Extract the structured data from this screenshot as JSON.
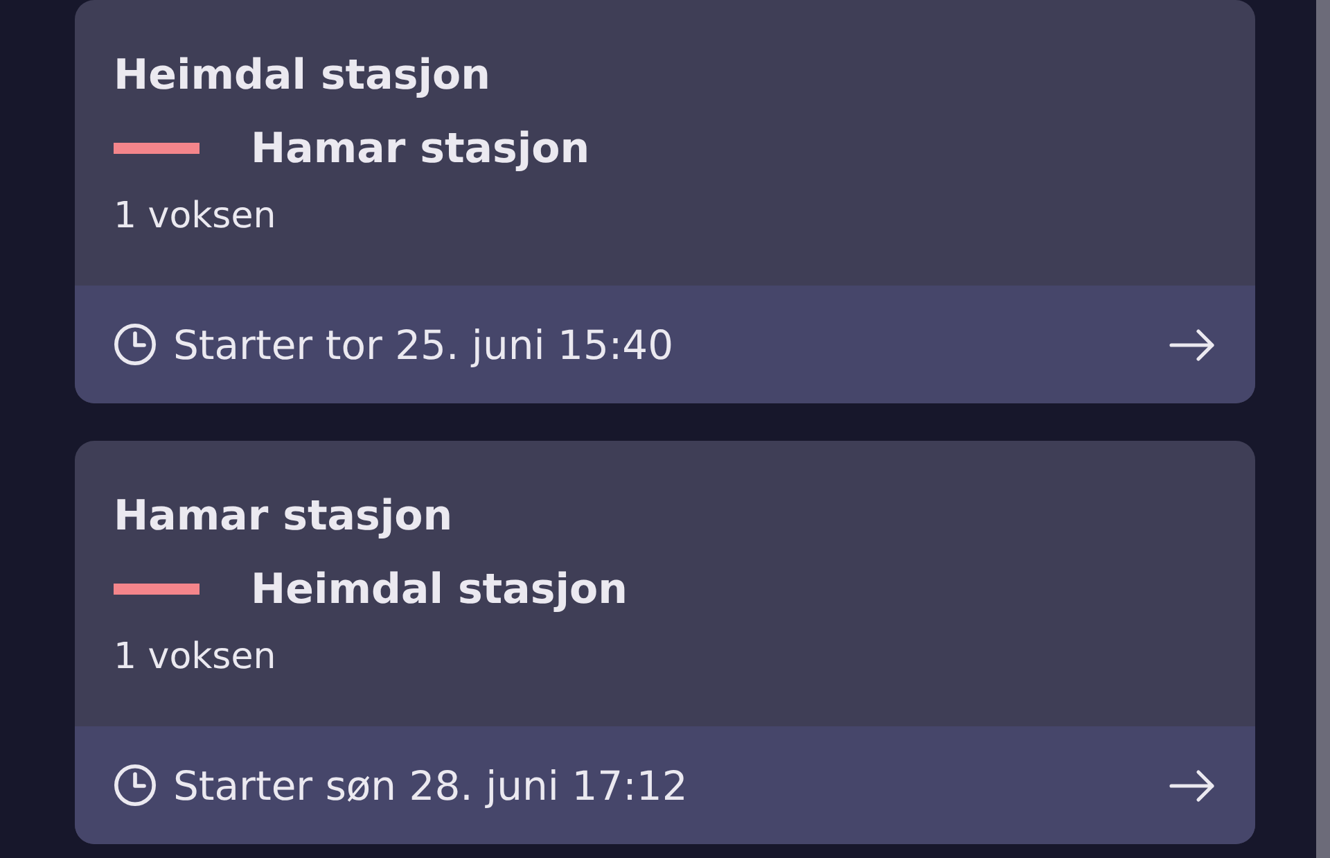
{
  "trips": [
    {
      "from": "Heimdal stasjon",
      "to": "Hamar stasjon",
      "passengers": "1 voksen",
      "departure": "Starter tor 25. juni 15:40"
    },
    {
      "from": "Hamar stasjon",
      "to": "Heimdal stasjon",
      "passengers": "1 voksen",
      "departure": "Starter søn 28. juni 17:12"
    }
  ]
}
